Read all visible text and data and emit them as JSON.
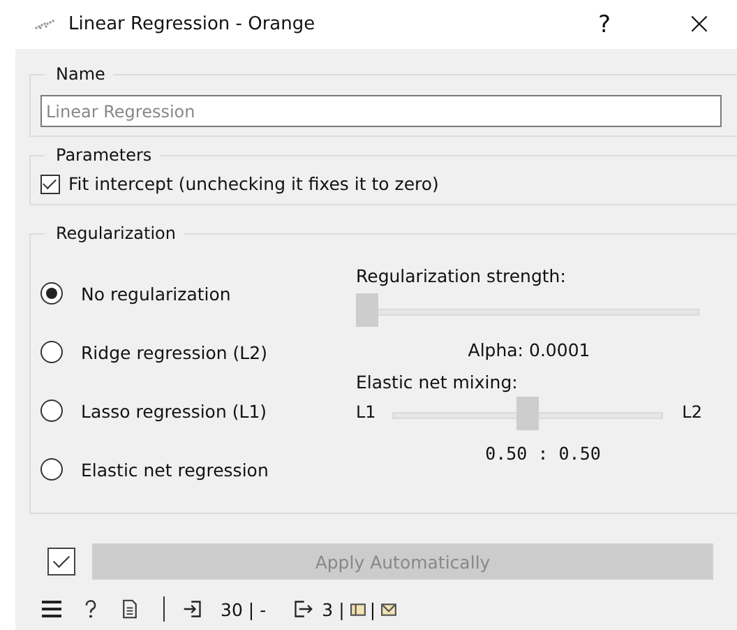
{
  "window": {
    "title": "Linear Regression - Orange",
    "buttons": [
      "?",
      "×"
    ]
  },
  "name_box": {
    "title": "Name",
    "placeholder": "Linear Regression"
  },
  "parameters": {
    "title": "Parameters",
    "checkbox": {
      "label": "Fit intercept (unchecking it fixes it to zero)",
      "checked": true
    }
  },
  "regularization": {
    "title": "Regularization",
    "options": [
      {
        "label": "No regularization",
        "selected": true
      },
      {
        "label": "Ridge regression (L2)",
        "selected": false
      },
      {
        "label": "Lasso regression (L1)",
        "selected": false
      },
      {
        "label": "Elastic net regression",
        "selected": false
      }
    ],
    "strength": {
      "label": "Regularization strength:",
      "level": 0,
      "reading": "Alpha: 0.0001"
    },
    "mixing": {
      "label": "Elastic net mixing:",
      "left": "L1",
      "right": "L2",
      "level": 0.5,
      "reading": "0.50 : 0.50"
    }
  },
  "apply": {
    "checked": true,
    "label": "Apply Automatically",
    "disabled": true
  },
  "status_bar": {
    "input_count": "30",
    "input_separator": "|",
    "input_detail": "-",
    "output_count": "3",
    "output_separator": "|",
    "icon_separator": "|"
  }
}
